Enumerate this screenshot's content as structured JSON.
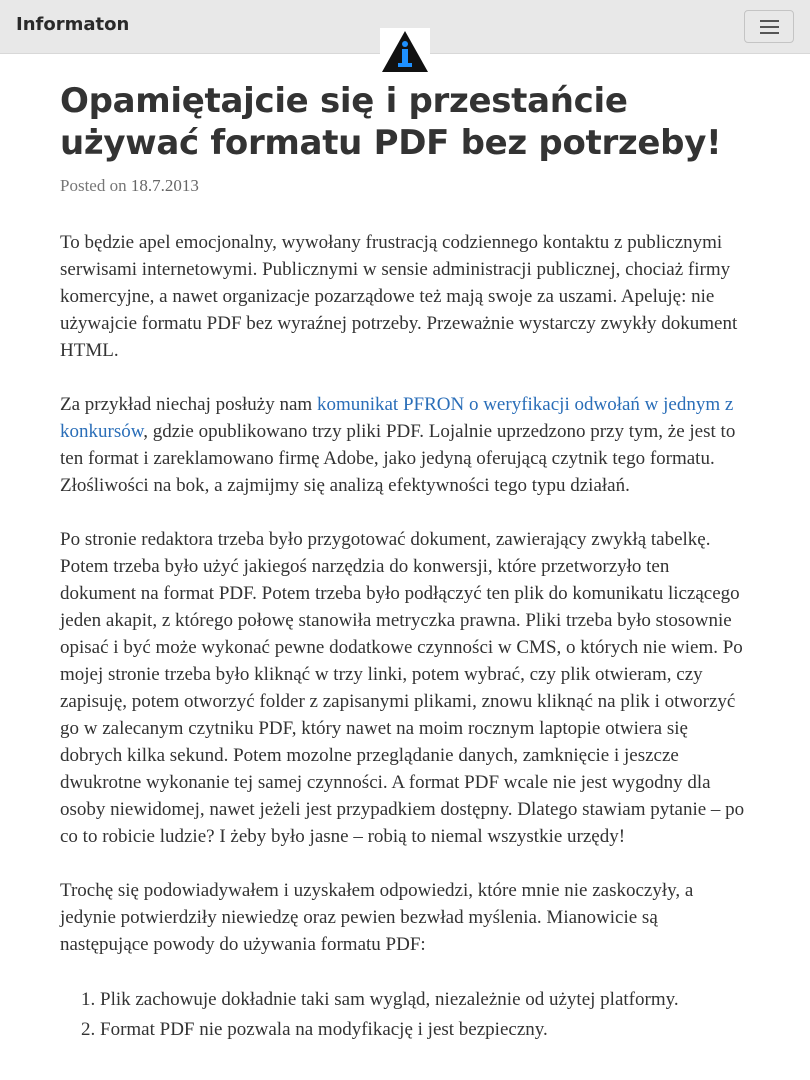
{
  "navbar": {
    "brand": "Informaton",
    "menu_icon": "hamburger-menu-icon",
    "logo_icon": "info-triangle-logo-icon",
    "colors": {
      "background": "#e8e8e8",
      "logo_accent": "#1e90ff"
    }
  },
  "article": {
    "title": "Opamiętajcie się i przestańcie używać formatu PDF bez potrzeby!",
    "posted_prefix": "Posted on",
    "posted_date": "18.7.2013",
    "p1": "To będzie apel emocjonalny, wywołany frustracją codziennego kontaktu z publicznymi serwisami internetowymi. Publicznymi w sensie administracji publicznej, chociaż firmy komercyjne, a nawet organizacje pozarządowe też mają swoje za uszami. Apeluję: nie używajcie formatu PDF bez wyraźnej potrzeby. Przeważnie wystarczy zwykły dokument HTML.",
    "p2_before": "Za przykład niechaj posłuży nam ",
    "p2_link": "komunikat PFRON o weryfikacji odwołań w jednym z konkursów",
    "p2_after": ", gdzie opublikowano trzy pliki PDF. Lojalnie uprzedzono przy tym, że jest to ten format i zareklamowano firmę Adobe, jako jedyną oferującą czytnik tego formatu. Złośliwości na bok, a zajmijmy się analizą efektywności tego typu działań.",
    "p3": "Po stronie redaktora trzeba było przygotować dokument, zawierający zwykłą tabelkę. Potem trzeba było użyć jakiegoś narzędzia do konwersji, które przetworzyło ten dokument na format PDF. Potem trzeba było podłączyć ten plik do komunikatu liczącego jeden akapit, z którego połowę stanowiła metryczka prawna. Pliki trzeba było stosownie opisać i być może wykonać pewne dodatkowe czynności w CMS, o których nie wiem. Po mojej stronie trzeba było kliknąć w trzy linki, potem wybrać, czy plik otwieram, czy zapisuję, potem otworzyć folder z zapisanymi plikami, znowu kliknąć na plik i otworzyć go w zalecanym czytniku PDF, który nawet na moim rocznym laptopie otwiera się dobrych kilka sekund. Potem mozolne przeglądanie danych, zamknięcie i jeszcze dwukrotne wykonanie tej samej czynności. A format PDF wcale nie jest wygodny dla osoby niewidomej, nawet jeżeli jest przypadkiem dostępny. Dlatego stawiam pytanie – po co to robicie ludzie? I żeby było jasne – robią to niemal wszystkie urzędy!",
    "p4": "Trochę się podowiadywałem i uzyskałem odpowiedzi, które mnie nie zaskoczyły, a jedynie potwierdziły niewiedzę oraz pewien bezwład myślenia. Mianowicie są następujące powody do używania formatu PDF:",
    "reasons": [
      "Plik zachowuje dokładnie taki sam wygląd, niezależnie od użytej platformy.",
      "Format PDF nie pozwala na modyfikację i jest bezpieczny."
    ]
  }
}
